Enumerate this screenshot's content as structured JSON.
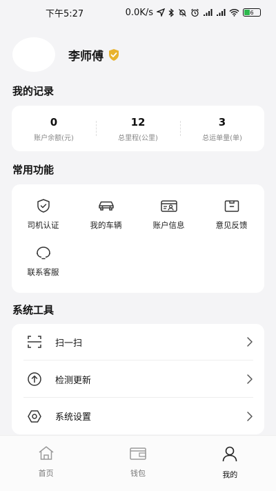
{
  "status_bar": {
    "time": "下午5:27",
    "net_speed": "0.0K/s",
    "battery": "6"
  },
  "profile": {
    "name": "李师傅",
    "icons": {
      "verified": "shield-check-icon"
    }
  },
  "records": {
    "title": "我的记录",
    "items": [
      {
        "value": "0",
        "label": "账户余额(元)"
      },
      {
        "value": "12",
        "label": "总里程(公里)"
      },
      {
        "value": "3",
        "label": "总运单量(单)"
      }
    ]
  },
  "functions": {
    "title": "常用功能",
    "items": [
      {
        "label": "司机认证",
        "icon": "shield-check-icon"
      },
      {
        "label": "我的车辆",
        "icon": "car-icon"
      },
      {
        "label": "账户信息",
        "icon": "id-card-icon"
      },
      {
        "label": "意见反馈",
        "icon": "feedback-icon"
      },
      {
        "label": "联系客服",
        "icon": "headset-icon"
      }
    ]
  },
  "tools": {
    "title": "系统工具",
    "items": [
      {
        "label": "扫一扫",
        "icon": "scan-icon"
      },
      {
        "label": "检测更新",
        "icon": "upload-icon"
      },
      {
        "label": "系统设置",
        "icon": "settings-icon"
      }
    ]
  },
  "tabbar": {
    "items": [
      {
        "label": "首页",
        "icon": "home-icon"
      },
      {
        "label": "钱包",
        "icon": "wallet-icon"
      },
      {
        "label": "我的",
        "icon": "user-icon",
        "active": true
      }
    ]
  },
  "colors": {
    "background": "#f4f4f6",
    "card": "#ffffff",
    "badge_gold": "#e8b32e",
    "text_secondary": "#888888"
  }
}
